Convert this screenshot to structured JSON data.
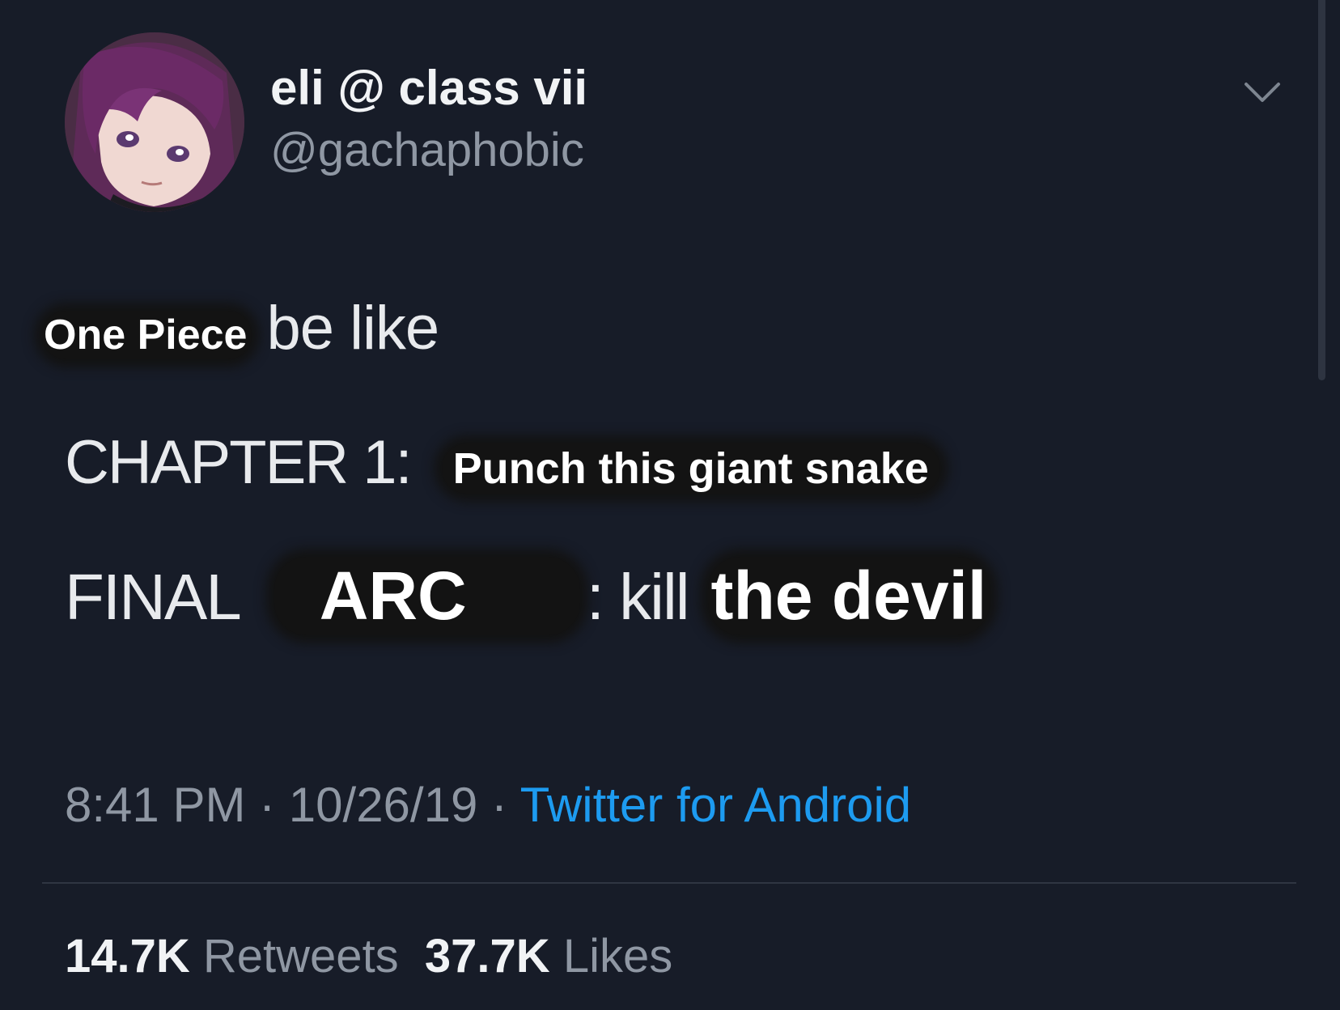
{
  "author": {
    "display_name": "eli @ class vii",
    "handle": "@gachaphobic"
  },
  "tweet": {
    "line1": {
      "edited": "One Piece",
      "text": "be like"
    },
    "line2": {
      "text": "CHAPTER 1:",
      "edited": "Punch this giant snake"
    },
    "line3": {
      "text": "FINAL",
      "edited1": "ARC",
      "text2": ": kill",
      "edited2": "the devil"
    }
  },
  "meta": {
    "time": "8:41 PM",
    "sep1": " · ",
    "date": "10/26/19",
    "sep2": " · ",
    "source": "Twitter for Android"
  },
  "stats": {
    "retweets_count": "14.7K",
    "retweets_label": "Retweets",
    "likes_count": "37.7K",
    "likes_label": "Likes"
  },
  "icons": {
    "menu": "chevron-down-icon",
    "avatar": "anime-avatar"
  },
  "colors": {
    "background": "#171c28",
    "link": "#1d9bf0",
    "muted": "#8f97a3"
  }
}
